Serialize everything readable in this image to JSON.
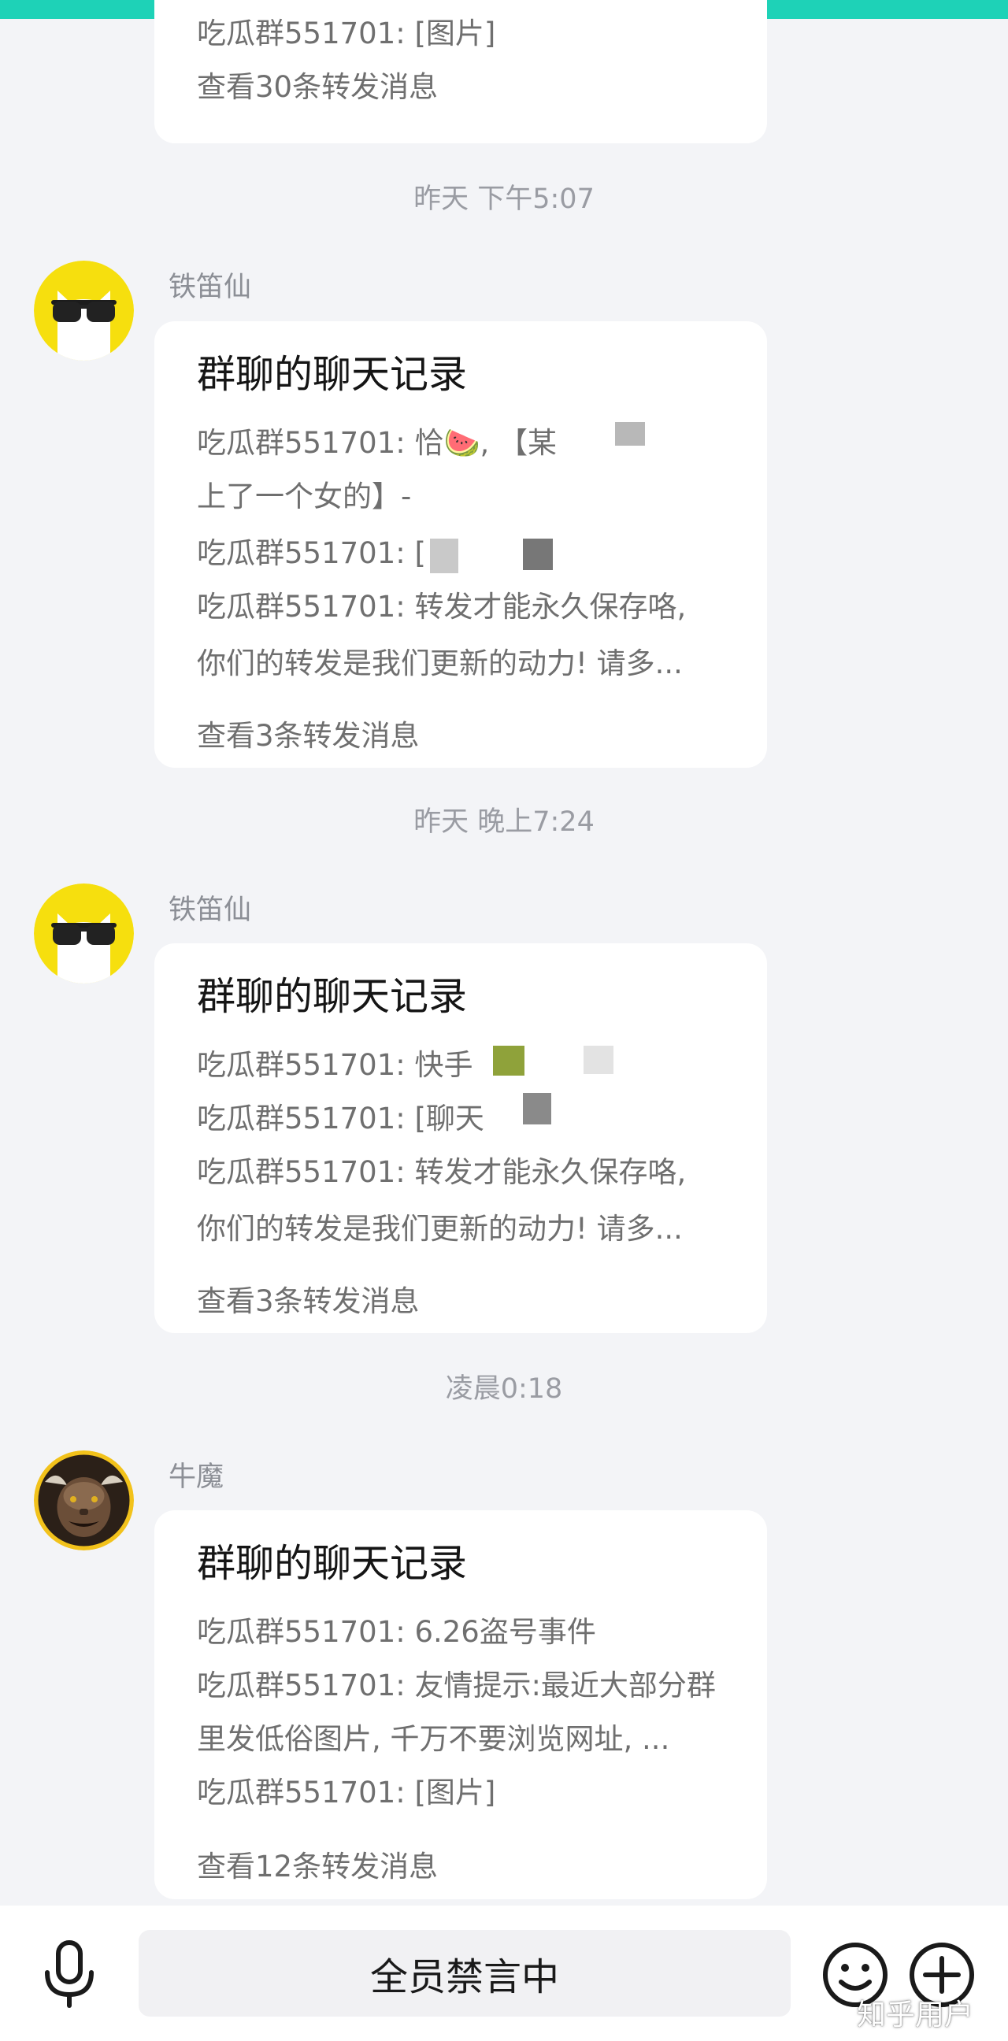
{
  "colors": {
    "accent_strip": "#1ed2b7",
    "background": "#f3f4f7",
    "card": "#ffffff",
    "secondary_text": "#6f6f6f",
    "timestamp_text": "#9a9ca3"
  },
  "top_partial_message": {
    "preview_line": "吃瓜群551701: [图片]",
    "view_link": "查看30条转发消息"
  },
  "messages": [
    {
      "timestamp": "昨天 下午5:07",
      "sender": "铁笛仙",
      "avatar_icon": "sunglasses-cat-avatar",
      "title": "群聊的聊天记录",
      "lines": [
        "吃瓜群551701: 恰🍉, 【某",
        "上了一个女的】-",
        "吃瓜群551701: [",
        "吃瓜群551701: 转发才能永久保存咯,",
        "你们的转发是我们更新的动力! 请多..."
      ],
      "view_link": "查看3条转发消息"
    },
    {
      "timestamp": "昨天 晚上7:24",
      "sender": "铁笛仙",
      "avatar_icon": "sunglasses-cat-avatar",
      "title": "群聊的聊天记录",
      "lines": [
        "吃瓜群551701: 快手",
        "吃瓜群551701: [聊天",
        "吃瓜群551701: 转发才能永久保存咯,",
        "你们的转发是我们更新的动力! 请多..."
      ],
      "view_link": "查看3条转发消息"
    },
    {
      "timestamp": "凌晨0:18",
      "sender": "牛魔",
      "avatar_icon": "bull-demon-avatar",
      "title": "群聊的聊天记录",
      "lines": [
        "吃瓜群551701: 6.26盗号事件",
        "吃瓜群551701: 友情提示:最近大部分群",
        "里发低俗图片, 千万不要浏览网址, ...",
        "吃瓜群551701: [图片]"
      ],
      "view_link": "查看12条转发消息"
    }
  ],
  "bottom_bar": {
    "voice_icon": "microphone-icon",
    "muted_text": "全员禁言中",
    "emoji_icon": "smiley-icon",
    "plus_icon": "plus-circle-icon"
  },
  "watermark": "知乎用户"
}
